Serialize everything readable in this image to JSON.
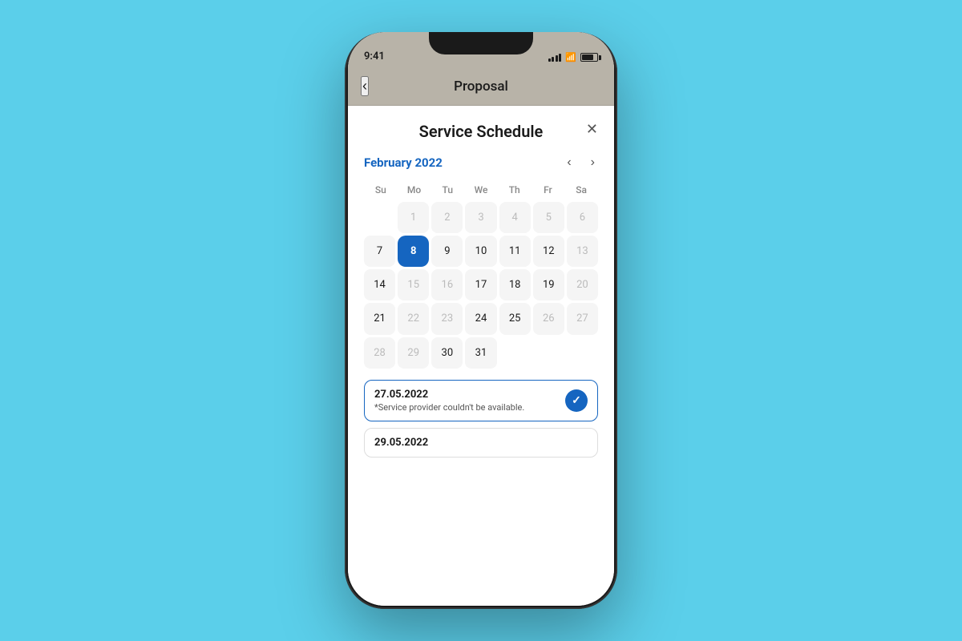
{
  "background": {
    "color": "#5BCFEA"
  },
  "phone": {
    "status_bar": {
      "time": "9:41",
      "signal_bars": 4,
      "wifi": true,
      "battery_percent": 75
    },
    "nav": {
      "back_icon": "‹",
      "title": "Proposal"
    },
    "modal": {
      "title": "Service Schedule",
      "close_icon": "✕",
      "calendar": {
        "month_year": "February 2022",
        "prev_icon": "‹",
        "next_icon": "›",
        "weekdays": [
          "Su",
          "Mo",
          "Tu",
          "We",
          "Th",
          "Fr",
          "Sa"
        ],
        "rows": [
          [
            {
              "day": "",
              "state": "empty"
            },
            {
              "day": "1",
              "state": "faded"
            },
            {
              "day": "2",
              "state": "faded"
            },
            {
              "day": "3",
              "state": "faded"
            },
            {
              "day": "4",
              "state": "faded"
            },
            {
              "day": "5",
              "state": "faded"
            },
            {
              "day": "6",
              "state": "faded"
            }
          ],
          [
            {
              "day": "7",
              "state": "normal"
            },
            {
              "day": "8",
              "state": "active"
            },
            {
              "day": "9",
              "state": "normal"
            },
            {
              "day": "10",
              "state": "normal"
            },
            {
              "day": "11",
              "state": "normal"
            },
            {
              "day": "12",
              "state": "normal"
            },
            {
              "day": "13",
              "state": "faded"
            }
          ],
          [
            {
              "day": "14",
              "state": "normal"
            },
            {
              "day": "15",
              "state": "faded"
            },
            {
              "day": "16",
              "state": "faded"
            },
            {
              "day": "17",
              "state": "normal"
            },
            {
              "day": "18",
              "state": "normal"
            },
            {
              "day": "19",
              "state": "normal"
            },
            {
              "day": "20",
              "state": "faded"
            }
          ],
          [
            {
              "day": "21",
              "state": "normal"
            },
            {
              "day": "22",
              "state": "faded"
            },
            {
              "day": "23",
              "state": "faded"
            },
            {
              "day": "24",
              "state": "normal"
            },
            {
              "day": "25",
              "state": "normal"
            },
            {
              "day": "26",
              "state": "faded"
            },
            {
              "day": "27",
              "state": "faded"
            }
          ],
          [
            {
              "day": "28",
              "state": "faded"
            },
            {
              "day": "29",
              "state": "faded"
            },
            {
              "day": "30",
              "state": "normal"
            },
            {
              "day": "31",
              "state": "normal"
            },
            {
              "day": "",
              "state": "empty"
            },
            {
              "day": "",
              "state": "empty"
            },
            {
              "day": "",
              "state": "empty"
            }
          ]
        ]
      },
      "schedule_items": [
        {
          "date": "27.05.2022",
          "note": "*Service provider couldn't be available.",
          "checked": true
        },
        {
          "date": "29.05.2022",
          "note": "",
          "checked": false
        }
      ]
    }
  }
}
